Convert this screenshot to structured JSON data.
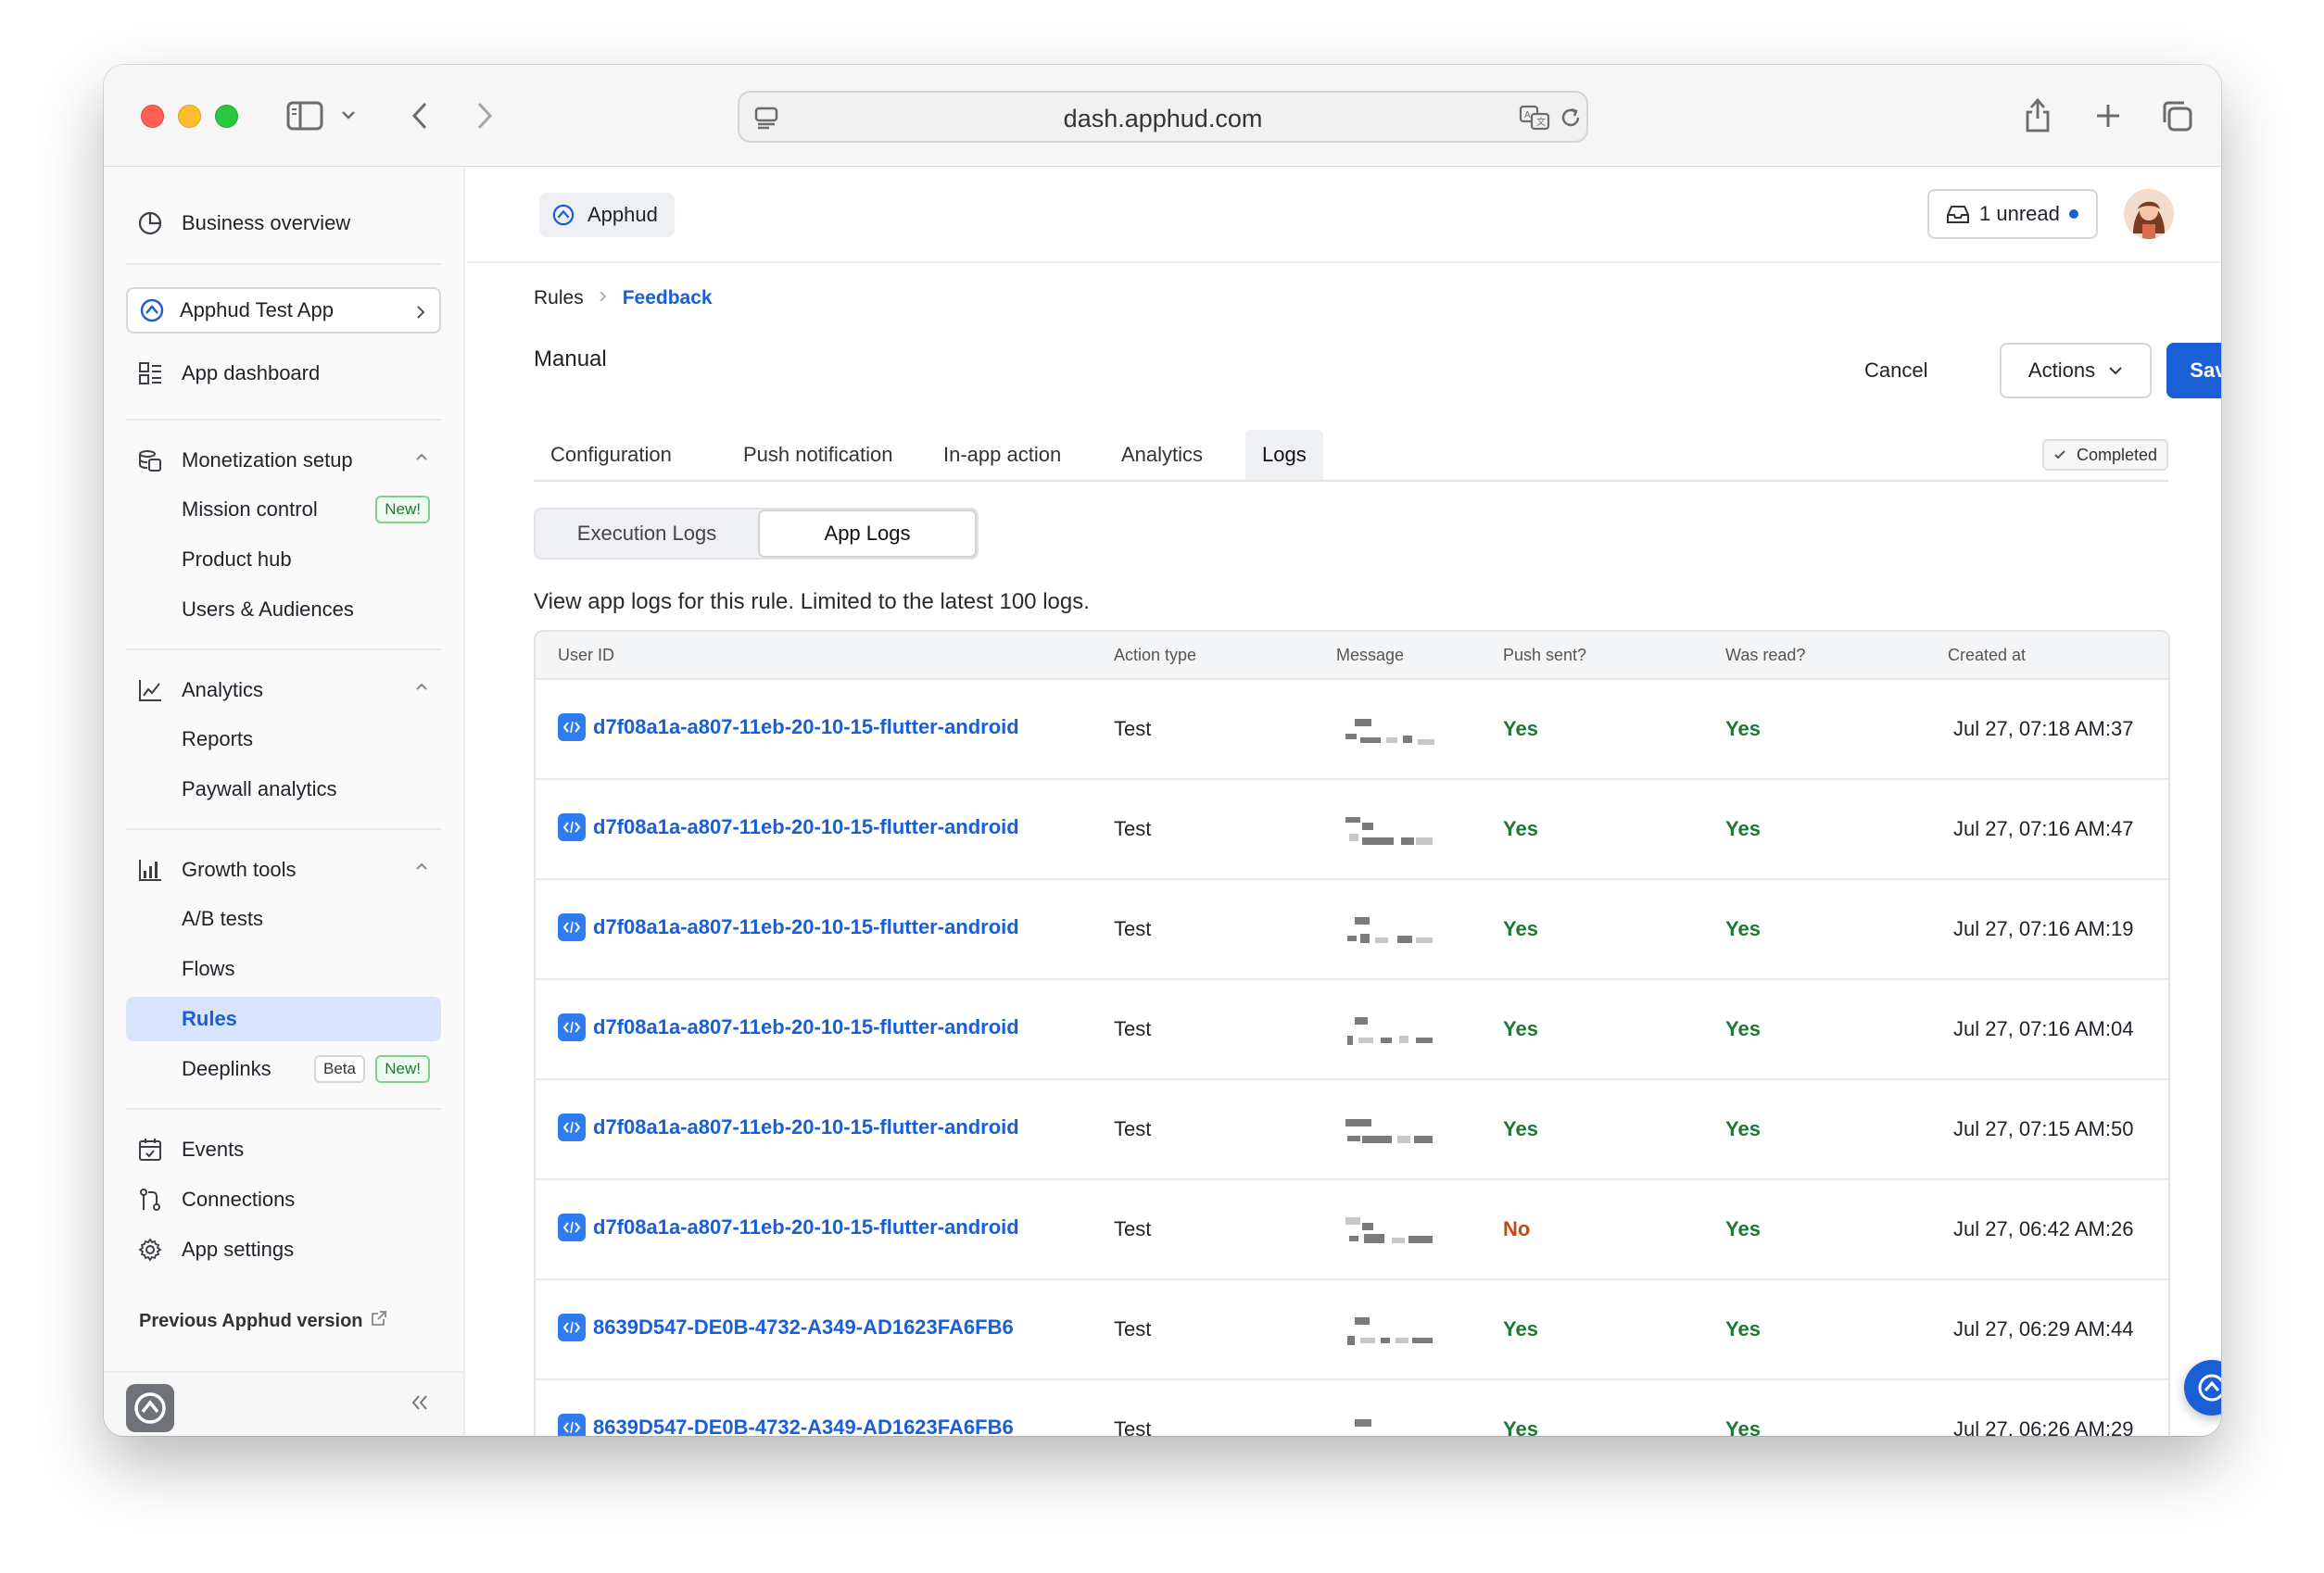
{
  "browser": {
    "url": "dash.apphud.com"
  },
  "sidebar": {
    "business_overview": "Business overview",
    "app_selector": "Apphud Test App",
    "app_dashboard": "App dashboard",
    "monetization": {
      "label": "Monetization setup",
      "items": [
        {
          "label": "Mission control",
          "badge": "New!"
        },
        {
          "label": "Product hub"
        },
        {
          "label": "Users & Audiences"
        }
      ]
    },
    "analytics": {
      "label": "Analytics",
      "items": [
        {
          "label": "Reports"
        },
        {
          "label": "Paywall analytics"
        }
      ]
    },
    "growth": {
      "label": "Growth tools",
      "items": [
        {
          "label": "A/B tests"
        },
        {
          "label": "Flows"
        },
        {
          "label": "Rules"
        },
        {
          "label": "Deeplinks",
          "badge_beta": "Beta",
          "badge": "New!"
        }
      ],
      "active_item": "Rules"
    },
    "events": "Events",
    "connections": "Connections",
    "app_settings": "App settings",
    "previous_version": "Previous Apphud version",
    "collapse_icon": "double-chevron-left-icon"
  },
  "topbar": {
    "app_name": "Apphud",
    "unread": "1 unread"
  },
  "breadcrumb": {
    "root": "Rules",
    "current": "Feedback"
  },
  "page": {
    "title": "Manual",
    "cancel": "Cancel",
    "actions": "Actions",
    "save": "Save"
  },
  "tabs": [
    {
      "label": "Configuration"
    },
    {
      "label": "Push notification"
    },
    {
      "label": "In-app action"
    },
    {
      "label": "Analytics"
    },
    {
      "label": "Logs"
    }
  ],
  "active_tab": "Logs",
  "status_badge": "Completed",
  "segments": {
    "execution": "Execution Logs",
    "app": "App Logs",
    "active": "App Logs"
  },
  "description": "View app logs for this rule. Limited to the latest 100 logs.",
  "table": {
    "headers": [
      "User ID",
      "Action type",
      "Message",
      "Push sent?",
      "Was read?",
      "Created at"
    ],
    "rows": [
      {
        "user_id": "d7f08a1a-a807-11eb-20-10-15-flutter-android",
        "action": "Test",
        "push": "Yes",
        "read": "Yes",
        "created": "Jul 27, 07:18 AM:37"
      },
      {
        "user_id": "d7f08a1a-a807-11eb-20-10-15-flutter-android",
        "action": "Test",
        "push": "Yes",
        "read": "Yes",
        "created": "Jul 27, 07:16 AM:47"
      },
      {
        "user_id": "d7f08a1a-a807-11eb-20-10-15-flutter-android",
        "action": "Test",
        "push": "Yes",
        "read": "Yes",
        "created": "Jul 27, 07:16 AM:19"
      },
      {
        "user_id": "d7f08a1a-a807-11eb-20-10-15-flutter-android",
        "action": "Test",
        "push": "Yes",
        "read": "Yes",
        "created": "Jul 27, 07:16 AM:04"
      },
      {
        "user_id": "d7f08a1a-a807-11eb-20-10-15-flutter-android",
        "action": "Test",
        "push": "Yes",
        "read": "Yes",
        "created": "Jul 27, 07:15 AM:50"
      },
      {
        "user_id": "d7f08a1a-a807-11eb-20-10-15-flutter-android",
        "action": "Test",
        "push": "No",
        "read": "Yes",
        "created": "Jul 27, 06:42 AM:26"
      },
      {
        "user_id": "8639D547-DE0B-4732-A349-AD1623FA6FB6",
        "action": "Test",
        "push": "Yes",
        "read": "Yes",
        "created": "Jul 27, 06:29 AM:44"
      },
      {
        "user_id": "8639D547-DE0B-4732-A349-AD1623FA6FB6",
        "action": "Test",
        "push": "Yes",
        "read": "Yes",
        "created": "Jul 27, 06:26 AM:29"
      }
    ]
  },
  "colors": {
    "accent": "#1a5fd6",
    "yes": "#1c7a32",
    "no": "#c44a10"
  }
}
